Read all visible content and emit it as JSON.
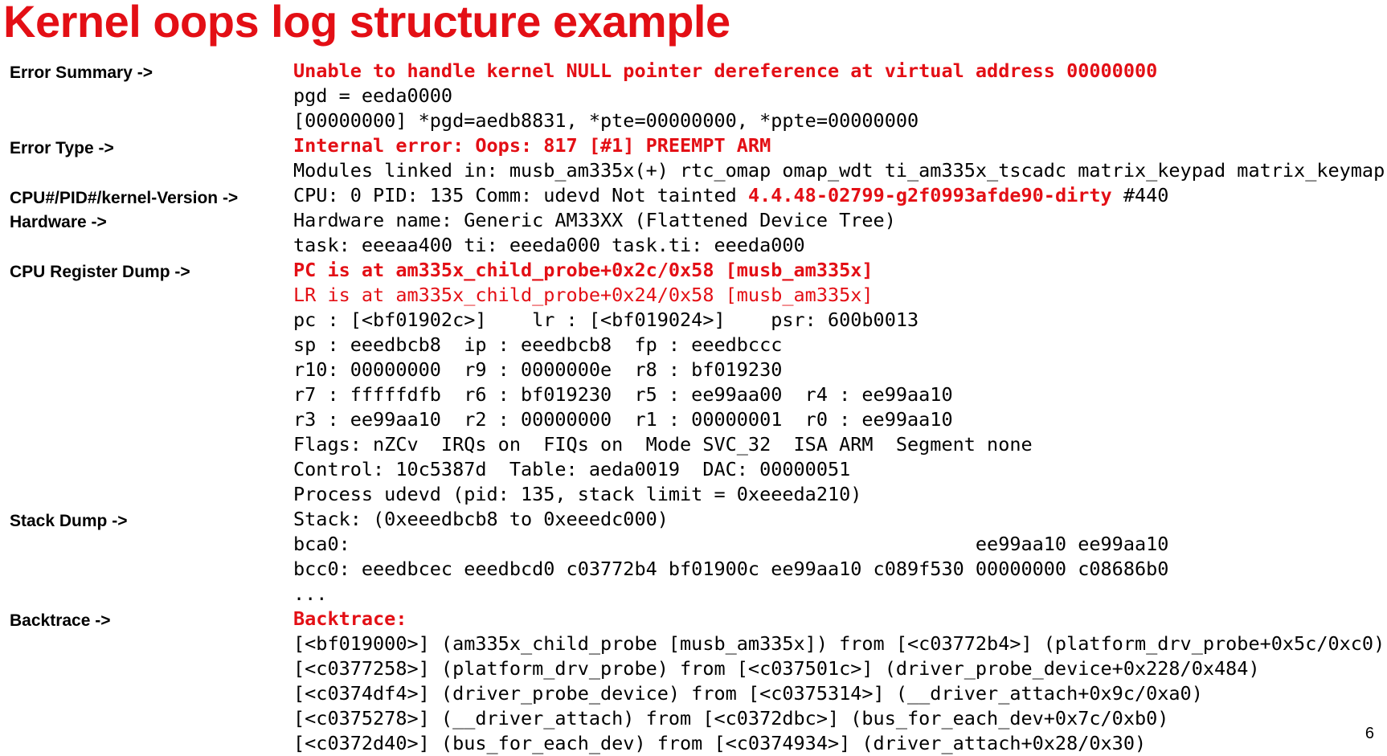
{
  "title": "Kernel oops log structure example",
  "labels": [
    "Error Summary ->",
    "Error Type ->",
    "CPU#/PID#/kernel-Version ->",
    "Hardware ->",
    "CPU Register Dump ->",
    "Stack Dump ->",
    "Backtrace ->"
  ],
  "log_lines": [
    [
      {
        "text": "Unable to handle kernel NULL pointer dereference at virtual address 00000000",
        "red": true,
        "bold": true
      }
    ],
    [
      {
        "text": "pgd = eeda0000"
      }
    ],
    [
      {
        "text": "[00000000] *pgd=aedb8831, *pte=00000000, *ppte=00000000"
      }
    ],
    [
      {
        "text": "Internal error: Oops: 817 [#1] PREEMPT ARM",
        "red": true,
        "bold": true
      }
    ],
    [
      {
        "text": "Modules linked in: musb_am335x(+) rtc_omap omap_wdt ti_am335x_tscadc matrix_keypad matrix_keymap"
      }
    ],
    [
      {
        "text": "CPU: 0 PID: 135 Comm: udevd Not tainted "
      },
      {
        "text": "4.4.48-02799-g2f0993afde90-dirty",
        "red": true,
        "bold": true
      },
      {
        "text": " #440"
      }
    ],
    [
      {
        "text": "Hardware name: Generic AM33XX (Flattened Device Tree)"
      }
    ],
    [
      {
        "text": "task: eeeaa400 ti: eeeda000 task.ti: eeeda000"
      }
    ],
    [
      {
        "text": "PC is at am335x_child_probe+0x2c/0x58 [musb_am335x]",
        "red": true,
        "bold": true
      }
    ],
    [
      {
        "text": "LR is at am335x_child_probe+0x24/0x58 [musb_am335x]",
        "red": true
      }
    ],
    [
      {
        "text": "pc : [<bf01902c>]    lr : [<bf019024>]    psr: 600b0013"
      }
    ],
    [
      {
        "text": "sp : eeedbcb8  ip : eeedbcb8  fp : eeedbccc"
      }
    ],
    [
      {
        "text": "r10: 00000000  r9 : 0000000e  r8 : bf019230"
      }
    ],
    [
      {
        "text": "r7 : fffffdfb  r6 : bf019230  r5 : ee99aa00  r4 : ee99aa10"
      }
    ],
    [
      {
        "text": "r3 : ee99aa10  r2 : 00000000  r1 : 00000001  r0 : ee99aa10"
      }
    ],
    [
      {
        "text": "Flags: nZCv  IRQs on  FIQs on  Mode SVC_32  ISA ARM  Segment none"
      }
    ],
    [
      {
        "text": "Control: 10c5387d  Table: aeda0019  DAC: 00000051"
      }
    ],
    [
      {
        "text": "Process udevd (pid: 135, stack limit = 0xeeeda210)"
      }
    ],
    [
      {
        "text": "Stack: (0xeeedbcb8 to 0xeeedc000)"
      }
    ],
    [
      {
        "text": "bca0:                                                       ee99aa10 ee99aa10"
      }
    ],
    [
      {
        "text": "bcc0: eeedbcec eeedbcd0 c03772b4 bf01900c ee99aa10 c089f530 00000000 c08686b0"
      }
    ],
    [
      {
        "text": "..."
      }
    ],
    [
      {
        "text": "Backtrace:",
        "red": true,
        "bold": true
      }
    ],
    [
      {
        "text": "[<bf019000>] (am335x_child_probe [musb_am335x]) from [<c03772b4>] (platform_drv_probe+0x5c/0xc0)"
      }
    ],
    [
      {
        "text": "[<c0377258>] (platform_drv_probe) from [<c037501c>] (driver_probe_device+0x228/0x484)"
      }
    ],
    [
      {
        "text": "[<c0374df4>] (driver_probe_device) from [<c0375314>] (__driver_attach+0x9c/0xa0)"
      }
    ],
    [
      {
        "text": "[<c0375278>] (__driver_attach) from [<c0372dbc>] (bus_for_each_dev+0x7c/0xb0)"
      }
    ],
    [
      {
        "text": "[<c0372d40>] (bus_for_each_dev) from [<c0374934>] (driver_attach+0x28/0x30)"
      }
    ]
  ],
  "page_number": "6",
  "colors": {
    "accent_red": "#e30f15",
    "text": "#000000",
    "background": "#ffffff"
  }
}
